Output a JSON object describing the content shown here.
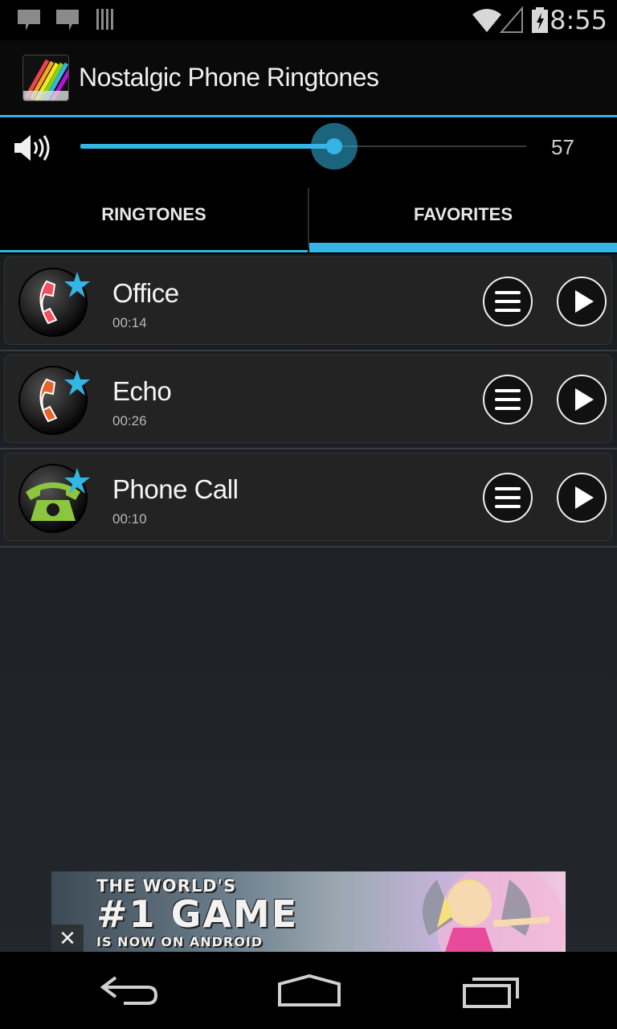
{
  "status_bar": {
    "time": "8:55",
    "icons": [
      "notification-icon",
      "notification-icon",
      "barcode-icon",
      "wifi-icon",
      "signal-icon",
      "battery-charging-icon"
    ]
  },
  "app": {
    "title": "Nostalgic Phone Ringtones",
    "icon": "app-logo-icon"
  },
  "volume": {
    "icon": "speaker-icon",
    "value": "57",
    "level_percent": 57
  },
  "tabs": [
    {
      "label": "RINGTONES",
      "selected": false
    },
    {
      "label": "FAVORITES",
      "selected": true
    }
  ],
  "favorites": [
    {
      "title": "Office",
      "duration": "00:14",
      "icon": "red-phone-icon",
      "favorite": true
    },
    {
      "title": "Echo",
      "duration": "00:26",
      "icon": "orange-phone-icon",
      "favorite": true
    },
    {
      "title": "Phone Call",
      "duration": "00:10",
      "icon": "green-telephone-icon",
      "favorite": true
    }
  ],
  "ad": {
    "line1": "THE WORLD'S",
    "line2": "#1 GAME",
    "line3": "IS NOW ON ANDROID",
    "close": "✕"
  },
  "nav": [
    "back-icon",
    "home-icon",
    "recents-icon"
  ],
  "colors": {
    "accent": "#33b5e5",
    "red_phone": "#e8454f",
    "orange_phone": "#e6632a",
    "green_phone": "#8cc63f"
  }
}
